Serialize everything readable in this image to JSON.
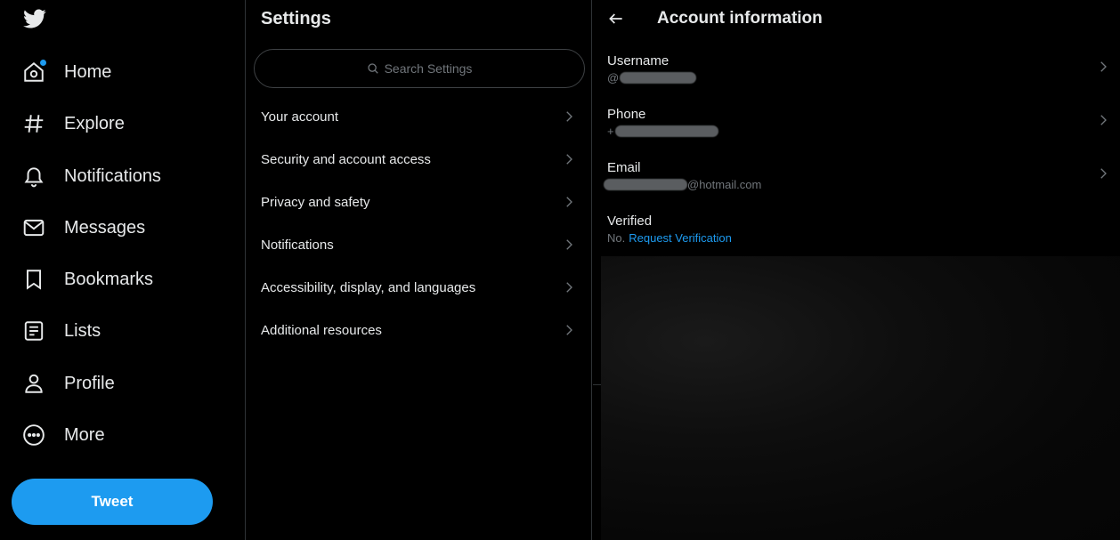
{
  "nav": {
    "items": [
      {
        "label": "Home",
        "icon": "home-icon"
      },
      {
        "label": "Explore",
        "icon": "hashtag-icon"
      },
      {
        "label": "Notifications",
        "icon": "bell-icon"
      },
      {
        "label": "Messages",
        "icon": "mail-icon"
      },
      {
        "label": "Bookmarks",
        "icon": "bookmark-icon"
      },
      {
        "label": "Lists",
        "icon": "list-icon"
      },
      {
        "label": "Profile",
        "icon": "person-icon"
      },
      {
        "label": "More",
        "icon": "more-circle-icon"
      }
    ],
    "tweet_label": "Tweet"
  },
  "settings": {
    "title": "Settings",
    "search_placeholder": "Search Settings",
    "items": [
      {
        "label": "Your account"
      },
      {
        "label": "Security and account access"
      },
      {
        "label": "Privacy and safety"
      },
      {
        "label": "Notifications"
      },
      {
        "label": "Accessibility, display, and languages"
      },
      {
        "label": "Additional resources"
      }
    ]
  },
  "account": {
    "title": "Account information",
    "username": {
      "label": "Username",
      "prefix": "@"
    },
    "phone": {
      "label": "Phone",
      "prefix": "+"
    },
    "email": {
      "label": "Email",
      "suffix": "@hotmail.com"
    },
    "verified": {
      "label": "Verified",
      "status": "No.",
      "link": "Request Verification"
    }
  },
  "colors": {
    "accent": "#1d9bf0",
    "background": "#000000",
    "text": "#e7e9ea",
    "muted": "#71767b",
    "border": "#2f3336"
  }
}
